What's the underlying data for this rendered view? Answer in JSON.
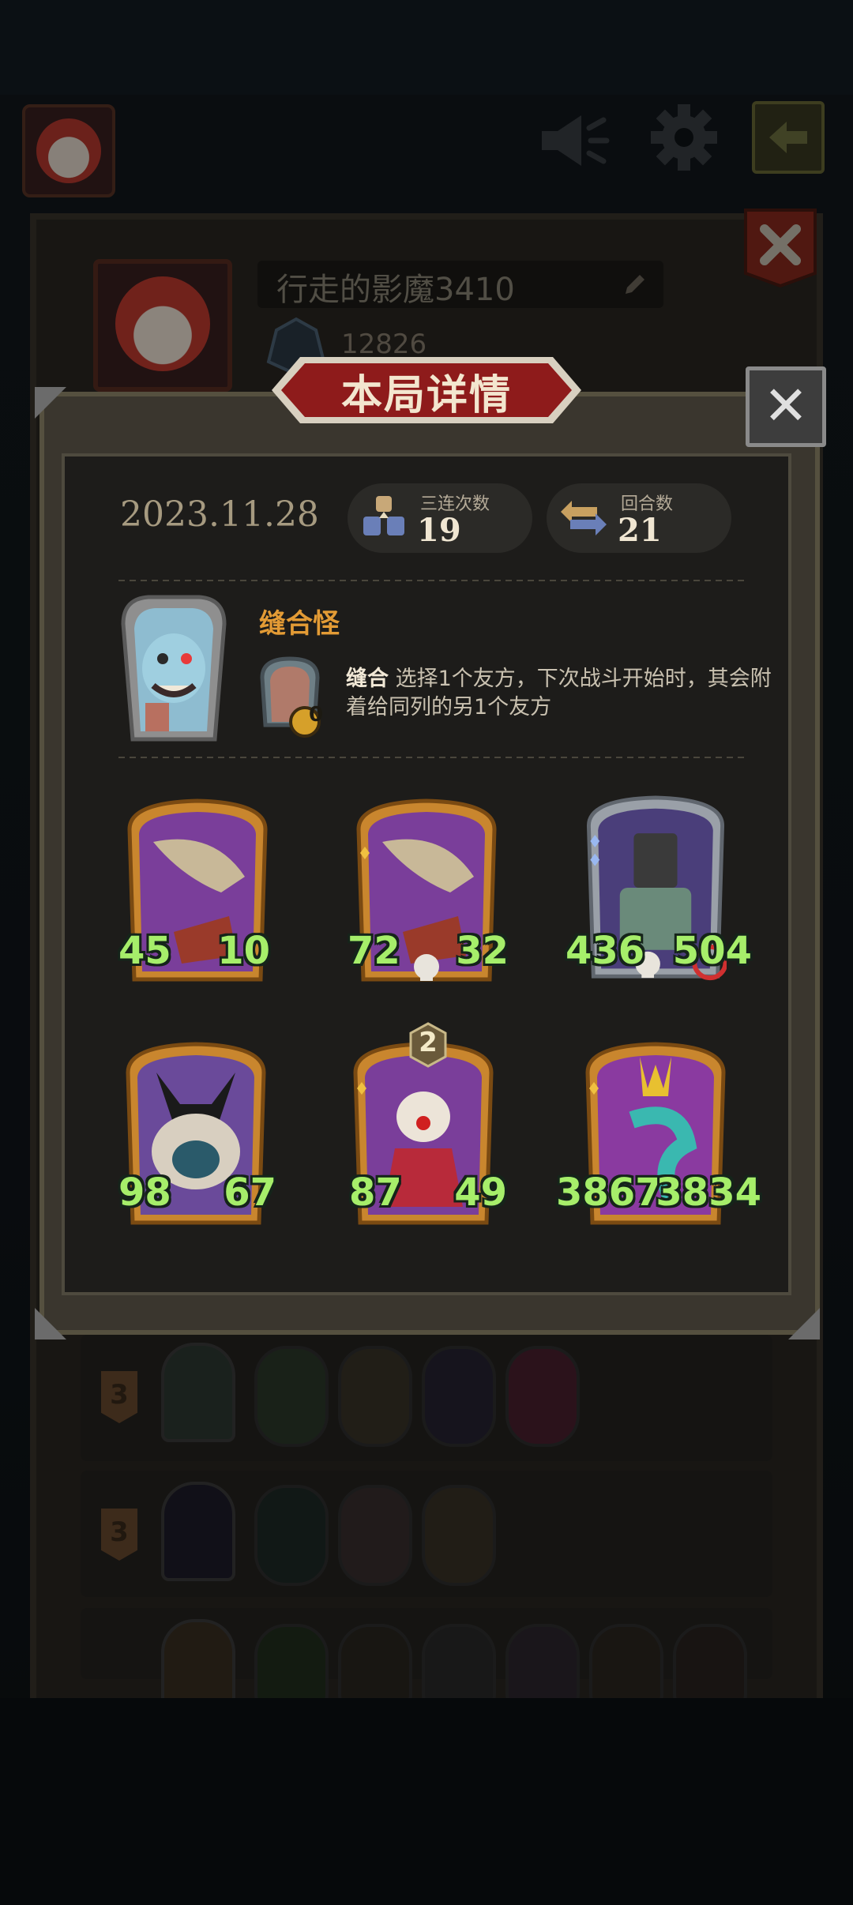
{
  "profile": {
    "player_name": "行走的影魔3410",
    "score": "12826"
  },
  "modal": {
    "title": "本局详情",
    "close_label": "✕",
    "date": "2023.11.28",
    "stats": [
      {
        "label": "三连次数",
        "value": "19",
        "icon": "triple-blocks-icon"
      },
      {
        "label": "回合数",
        "value": "21",
        "icon": "turn-arrows-icon"
      }
    ],
    "hero": {
      "name": "缝合怪",
      "skill_name": "缝合",
      "skill_desc": "选择1个友方，下次战斗开始时，其会附着给同列的另1个友方",
      "skill_cost": "0"
    },
    "minions": [
      {
        "attack": "45",
        "health": "10",
        "frame": "gold",
        "icon": "airship-icon",
        "deathrattle": false,
        "reborn": false
      },
      {
        "attack": "72",
        "health": "32",
        "frame": "gold",
        "icon": "airship-icon",
        "deathrattle": true,
        "reborn": false
      },
      {
        "attack": "436",
        "health": "504",
        "frame": "silver",
        "icon": "mech-knight-icon",
        "deathrattle": true,
        "reborn": true
      },
      {
        "attack": "98",
        "health": "67",
        "frame": "gold",
        "icon": "demon-beast-icon",
        "deathrattle": false,
        "reborn": false
      },
      {
        "attack": "87",
        "health": "49",
        "frame": "gold",
        "icon": "clown-icon",
        "deathrattle": false,
        "reborn": false,
        "badge": "2"
      },
      {
        "attack": "3867",
        "health": "3834",
        "frame": "gold",
        "icon": "serpent-queen-icon",
        "deathrattle": false,
        "reborn": false
      }
    ]
  },
  "history": {
    "rows": [
      {
        "level": "3",
        "card_count": 4
      },
      {
        "level": "3",
        "card_count": 3
      },
      {
        "level": "",
        "card_count": 6
      }
    ]
  },
  "colors": {
    "stat_green": "#a6ee6a",
    "hero_name": "#e39b35",
    "banner_red": "#8e1b1b",
    "panel_bg": "#1d1c1a"
  }
}
